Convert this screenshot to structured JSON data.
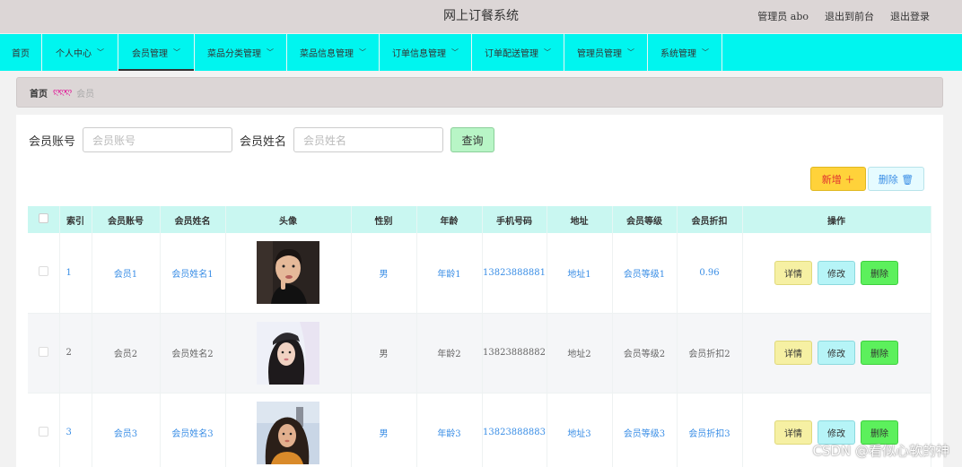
{
  "header": {
    "title": "网上订餐系统",
    "admin": "管理员 abo",
    "to_front": "退出到前台",
    "logout": "退出登录"
  },
  "nav": [
    {
      "label": "首页",
      "has_chevron": false
    },
    {
      "label": "个人中心",
      "has_chevron": true
    },
    {
      "label": "会员管理",
      "has_chevron": true
    },
    {
      "label": "菜品分类管理",
      "has_chevron": true
    },
    {
      "label": "菜品信息管理",
      "has_chevron": true
    },
    {
      "label": "订单信息管理",
      "has_chevron": true
    },
    {
      "label": "订单配送管理",
      "has_chevron": true
    },
    {
      "label": "管理员管理",
      "has_chevron": true
    },
    {
      "label": "系统管理",
      "has_chevron": true
    }
  ],
  "nav_active": "会员管理",
  "breadcrumb": {
    "home": "首页",
    "separator": "ღღღ",
    "current": "会员"
  },
  "search": {
    "account_label": "会员账号",
    "account_placeholder": "会员账号",
    "name_label": "会员姓名",
    "name_placeholder": "会员姓名",
    "query_button": "查询"
  },
  "actions": {
    "add": "新增 ＋",
    "delete": "删除 🗑"
  },
  "table": {
    "headers": [
      "索引",
      "会员账号",
      "会员姓名",
      "头像",
      "性别",
      "年龄",
      "手机号码",
      "地址",
      "会员等级",
      "会员折扣",
      "操作"
    ],
    "rows": [
      {
        "index": "1",
        "account": "会员1",
        "name": "会员姓名1",
        "gender": "男",
        "age": "年龄1",
        "phone": "13823888881",
        "address": "地址1",
        "level": "会员等级1",
        "discount": "0.96"
      },
      {
        "index": "2",
        "account": "会员2",
        "name": "会员姓名2",
        "gender": "男",
        "age": "年龄2",
        "phone": "13823888882",
        "address": "地址2",
        "level": "会员等级2",
        "discount": "会员折扣2"
      },
      {
        "index": "3",
        "account": "会员3",
        "name": "会员姓名3",
        "gender": "男",
        "age": "年龄3",
        "phone": "13823888883",
        "address": "地址3",
        "level": "会员等级3",
        "discount": "会员折扣3"
      }
    ],
    "op_labels": {
      "detail": "详情",
      "edit": "修改",
      "delete": "删除"
    }
  },
  "watermark": "CSDN @看似心软的神",
  "colors": {
    "nav_bg": "#00f5ef",
    "header_bg": "#dcd6d6",
    "table_head_bg": "#c9f7f1",
    "link": "#3a8ee6"
  }
}
